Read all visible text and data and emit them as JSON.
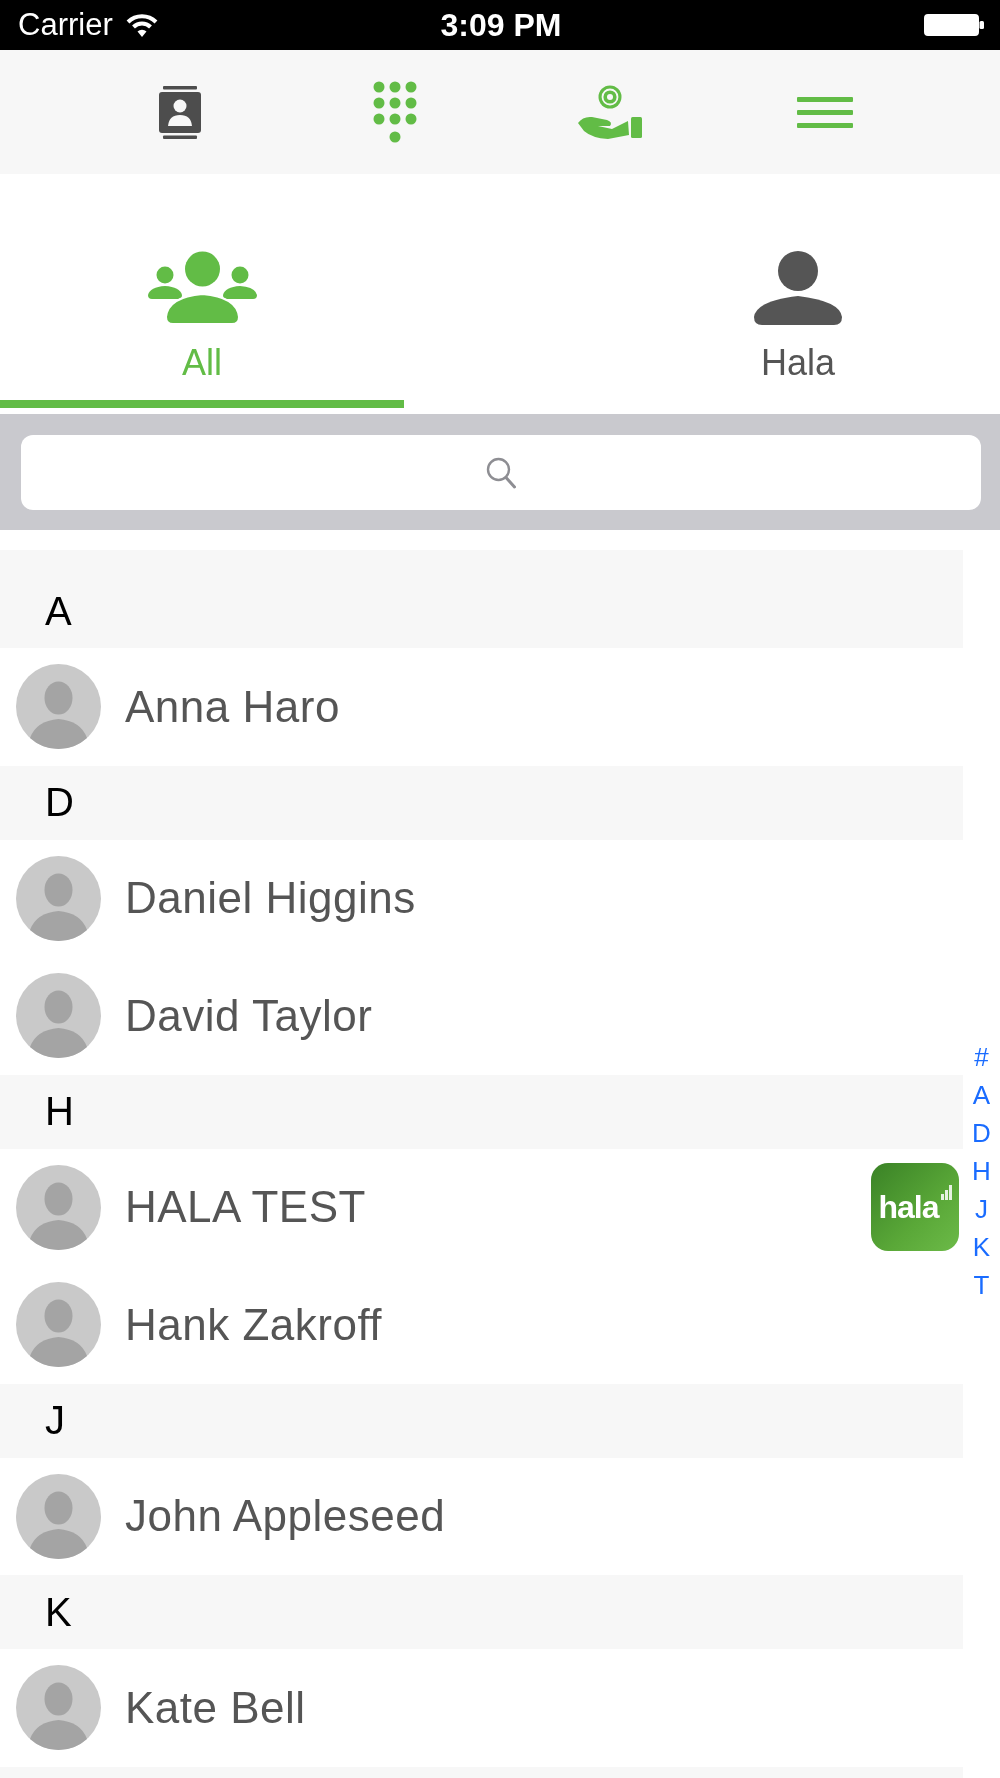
{
  "status_bar": {
    "carrier": "Carrier",
    "time": "3:09 PM"
  },
  "toolbar": {
    "buttons": [
      {
        "selected": true
      },
      {
        "selected": false
      },
      {
        "selected": false
      },
      {
        "selected": false
      }
    ]
  },
  "tabs": [
    {
      "label": "All",
      "selected": true
    },
    {
      "label": "Hala",
      "selected": false
    }
  ],
  "contact_list": {
    "sections": [
      {
        "letter": "A",
        "contacts": [
          {
            "name": "Anna Haro"
          }
        ]
      },
      {
        "letter": "D",
        "contacts": [
          {
            "name": "Daniel Higgins"
          },
          {
            "name": "David Taylor"
          }
        ]
      },
      {
        "letter": "H",
        "contacts": [
          {
            "name": "HALA TEST",
            "badge": "hala"
          },
          {
            "name": "Hank Zakroff"
          }
        ]
      },
      {
        "letter": "J",
        "contacts": [
          {
            "name": "John Appleseed"
          }
        ]
      },
      {
        "letter": "K",
        "contacts": [
          {
            "name": "Kate Bell"
          }
        ]
      }
    ],
    "index": [
      "#",
      "A",
      "D",
      "H",
      "J",
      "K",
      "T"
    ]
  }
}
